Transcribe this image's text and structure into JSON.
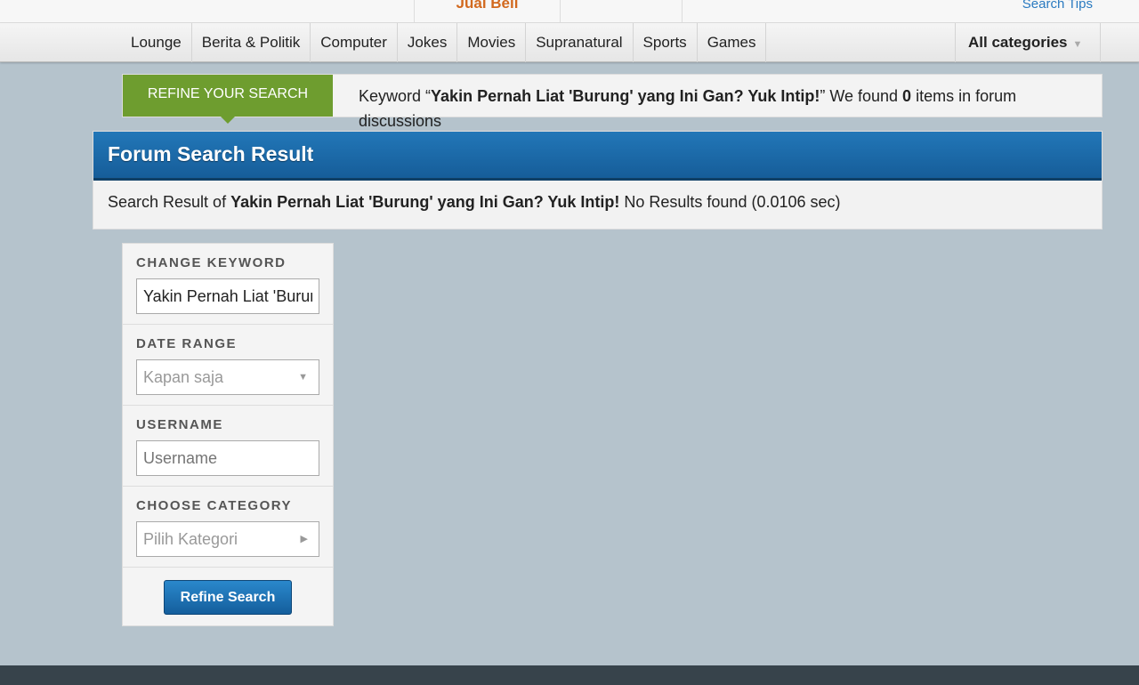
{
  "topbar": {
    "jual_beli": "Jual Beli",
    "search_tips": "Search Tips"
  },
  "nav": {
    "items": [
      "Lounge",
      "Berita & Politik",
      "Computer",
      "Jokes",
      "Movies",
      "Supranatural",
      "Sports",
      "Games"
    ],
    "all_categories": "All categories"
  },
  "refine": {
    "tag": "REFINE YOUR SEARCH",
    "prefix": "Keyword “",
    "keyword": "Yakin Pernah Liat 'Burung' yang Ini Gan? Yuk Intip!",
    "mid": "” We found ",
    "count": "0",
    "suffix": " items in forum discussions"
  },
  "result": {
    "title": "Forum Search Result",
    "prefix": "Search Result of ",
    "keyword": "Yakin Pernah Liat 'Burung' yang Ini Gan? Yuk Intip!",
    "status": " No Results found (0.0106 sec)"
  },
  "panel": {
    "keyword_label": "CHANGE KEYWORD",
    "keyword_value": "Yakin Pernah Liat 'Burung' yang Ini Gan? Yuk Intip!",
    "date_label": "DATE RANGE",
    "date_value": "Kapan saja",
    "username_label": "USERNAME",
    "username_placeholder": "Username",
    "category_label": "CHOOSE CATEGORY",
    "category_value": "Pilih Kategori",
    "button": "Refine Search"
  },
  "colors": {
    "accent": "#1f6fae",
    "refine_green": "#6e9d2f",
    "link": "#2a7ac0"
  }
}
